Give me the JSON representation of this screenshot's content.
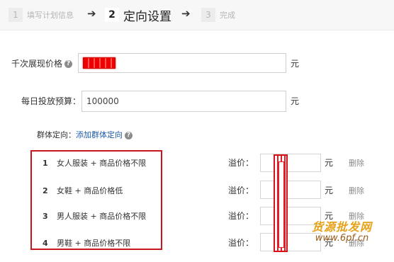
{
  "steps": {
    "step1": {
      "num": "1",
      "label": "填写计划信息"
    },
    "arrow": "➔",
    "step2": {
      "num": "2",
      "label": "定向设置"
    },
    "step3": {
      "num": "3",
      "label": "完成"
    }
  },
  "form": {
    "cpm_price": {
      "label": "千次展现价格",
      "unit": "元"
    },
    "daily_budget": {
      "label": "每日投放预算：",
      "value": "100000",
      "unit": "元"
    },
    "group": {
      "label": "群体定向：",
      "add_link": "添加群体定向"
    }
  },
  "targets": [
    {
      "num": "1",
      "label": "女人服装 + 商品价格不限",
      "premium_label": "溢价：",
      "unit": "元",
      "delete": "删除"
    },
    {
      "num": "2",
      "label": "女鞋 + 商品价格低",
      "premium_label": "溢价：",
      "unit": "元",
      "delete": "删除"
    },
    {
      "num": "3",
      "label": "男人服装 + 商品价格不限",
      "premium_label": "溢价：",
      "unit": "元",
      "delete": "删除"
    },
    {
      "num": "4",
      "label": "男鞋 + 商品价格不限",
      "premium_label": "溢价：",
      "unit": "元",
      "delete": "删除"
    }
  ],
  "watermark": {
    "line1": "货源批发网",
    "line2": "www.6pf.cn"
  },
  "colors": {
    "highlight_red": "#c7161d",
    "link_blue": "#1f5ca8",
    "watermark_orange": "#e6a21a"
  }
}
